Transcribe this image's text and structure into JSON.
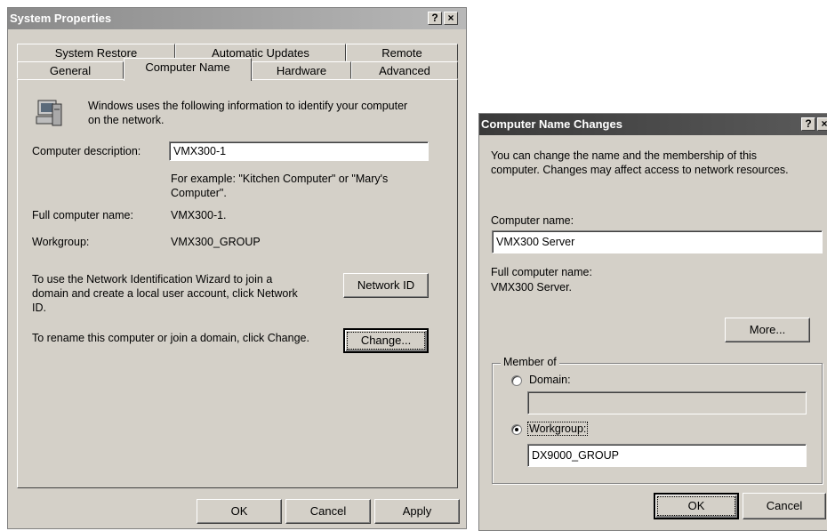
{
  "system_properties": {
    "title": "System Properties",
    "help_label": "?",
    "close_label": "×",
    "tabs_back": [
      "System Restore",
      "Automatic Updates",
      "Remote"
    ],
    "tabs_front": [
      "General",
      "Computer Name",
      "Hardware",
      "Advanced"
    ],
    "info_text_1": "Windows uses the following information to identify your computer",
    "info_text_2": "on the network.",
    "description_label": "Computer description:",
    "description_value": "VMX300-1",
    "example_1": "For example: \"Kitchen Computer\" or \"Mary's",
    "example_2": "Computer\".",
    "full_name_label": "Full computer name:",
    "full_name_value": "VMX300-1.",
    "workgroup_label": "Workgroup:",
    "workgroup_value": "VMX300_GROUP",
    "network_text_1": "To use the Network Identification Wizard to join a",
    "network_text_2": "domain and create a local user account, click Network",
    "network_text_3": "ID.",
    "network_id_button": "Network ID",
    "rename_text": "To rename this computer or join a domain, click Change.",
    "change_button": "Change...",
    "ok_button": "OK",
    "cancel_button": "Cancel",
    "apply_button": "Apply",
    "computer_icon": "computer-icon"
  },
  "name_changes": {
    "title": "Computer Name Changes",
    "help_label": "?",
    "close_label": "×",
    "intro_1": "You can change the name and the membership of this",
    "intro_2": "computer. Changes may affect access to network resources.",
    "computer_name_label": "Computer name:",
    "computer_name_value": "VMX300 Server",
    "full_name_label": "Full computer name:",
    "full_name_value": "VMX300 Server.",
    "more_button": "More...",
    "member_of_label": "Member of",
    "domain_label": "Domain:",
    "domain_value": "",
    "workgroup_label": "Workgroup:",
    "workgroup_value": "DX9000_GROUP",
    "selected_membership": "workgroup",
    "ok_button": "OK",
    "cancel_button": "Cancel"
  }
}
